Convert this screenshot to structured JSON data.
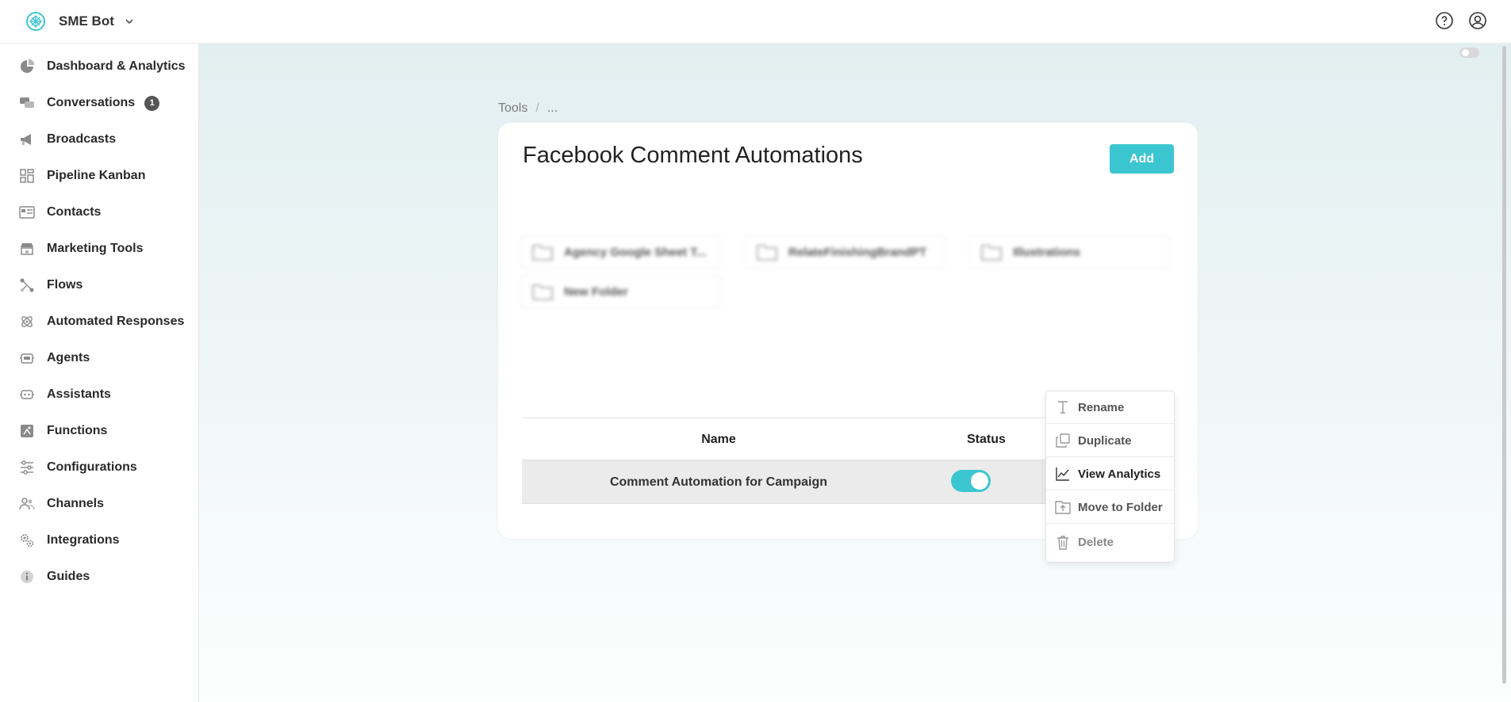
{
  "app": {
    "name": "SME Bot"
  },
  "sidebar": {
    "items": [
      {
        "label": "Dashboard & Analytics",
        "icon": "pie-chart-icon"
      },
      {
        "label": "Conversations",
        "icon": "chat-bubbles-icon",
        "badge": "1"
      },
      {
        "label": "Broadcasts",
        "icon": "megaphone-icon"
      },
      {
        "label": "Pipeline Kanban",
        "icon": "kanban-icon"
      },
      {
        "label": "Contacts",
        "icon": "contact-card-icon"
      },
      {
        "label": "Marketing Tools",
        "icon": "storefront-icon"
      },
      {
        "label": "Flows",
        "icon": "flow-nodes-icon"
      },
      {
        "label": "Automated Responses",
        "icon": "atom-icon"
      },
      {
        "label": "Agents",
        "icon": "agent-robot-icon"
      },
      {
        "label": "Assistants",
        "icon": "assistant-bot-icon"
      },
      {
        "label": "Functions",
        "icon": "function-icon"
      },
      {
        "label": "Configurations",
        "icon": "sliders-icon"
      },
      {
        "label": "Channels",
        "icon": "users-icon"
      },
      {
        "label": "Integrations",
        "icon": "gears-icon"
      },
      {
        "label": "Guides",
        "icon": "info-icon"
      }
    ]
  },
  "breadcrumb": {
    "root": "Tools",
    "separator": "/",
    "current": "..."
  },
  "page": {
    "title": "Facebook Comment Automations",
    "add_label": "Add"
  },
  "folders": [
    {
      "name": "Agency Google Sheet T..."
    },
    {
      "name": "RelateFinishingBrandPT"
    },
    {
      "name": "Illustrations"
    },
    {
      "name": "New Folder"
    }
  ],
  "table": {
    "columns": [
      "Name",
      "Status"
    ],
    "rows": [
      {
        "name": "Comment Automation for Campaign",
        "status": "on"
      }
    ]
  },
  "context_menu": {
    "items": [
      {
        "label": "Rename",
        "icon": "text-cursor-icon"
      },
      {
        "label": "Duplicate",
        "icon": "copy-icon"
      },
      {
        "label": "View Analytics",
        "icon": "line-chart-icon"
      },
      {
        "label": "Move to Folder",
        "icon": "folder-move-icon"
      },
      {
        "label": "Delete",
        "icon": "trash-icon"
      }
    ]
  },
  "colors": {
    "accent": "#3cc6d1",
    "badge": "#555555"
  }
}
